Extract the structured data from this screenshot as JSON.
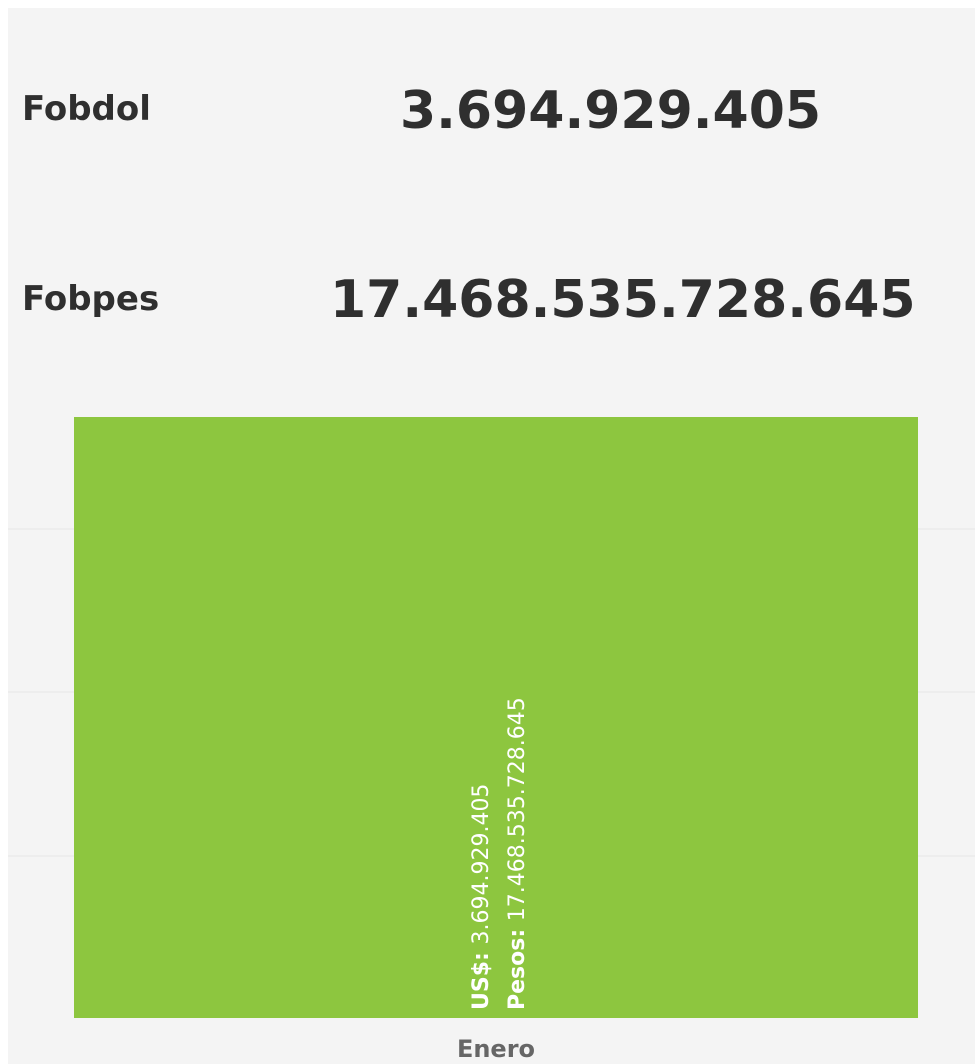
{
  "kpis": {
    "fobdol": {
      "label": "Fobdol",
      "value": "3.694.929.405"
    },
    "fobpes": {
      "label": "Fobpes",
      "value": "17.468.535.728.645"
    }
  },
  "colors": {
    "panel_bg": "#f4f4f4",
    "bar": "#8dc63f",
    "text_dark": "#2f2f2f",
    "grid": "#e6e6e6",
    "axis_label": "#666666",
    "bar_label": "#ffffff"
  },
  "chart_data": {
    "type": "bar",
    "categories": [
      "Enero"
    ],
    "series": [
      {
        "values": [
          3694929405
        ]
      }
    ],
    "data_labels": [
      {
        "line1_key": "US$:",
        "line1_value": "3.694.929.405",
        "line2_key": "Pesos:",
        "line2_value": "17.468.535.728.645"
      }
    ],
    "ylim": [
      0,
      3694929405
    ],
    "grid": true,
    "title": "",
    "xlabel": "",
    "ylabel": ""
  }
}
